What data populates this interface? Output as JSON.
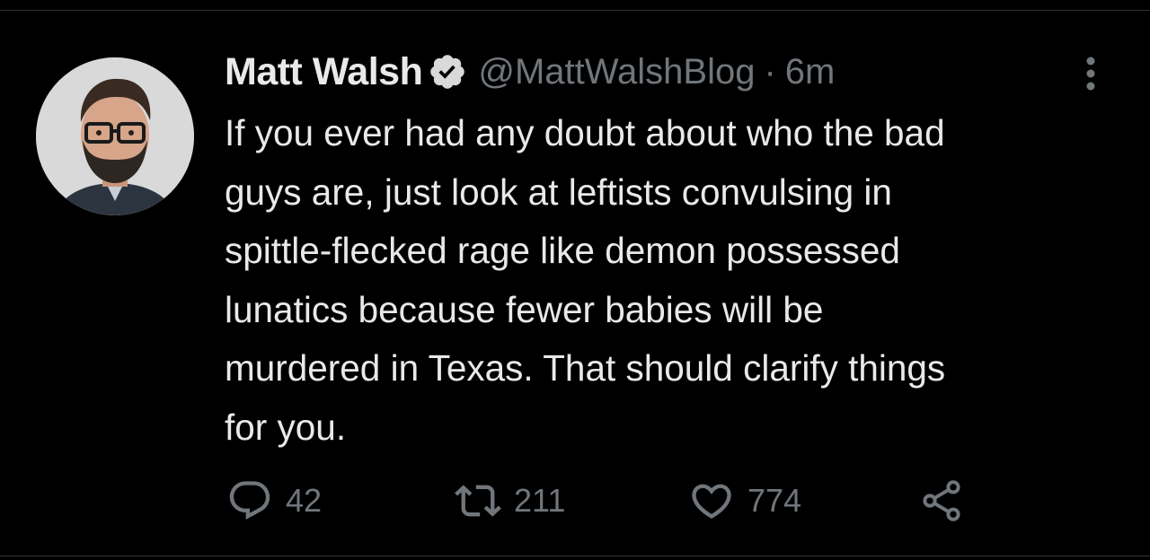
{
  "tweet": {
    "author": {
      "name": "Matt Walsh",
      "handle": "@MattWalshBlog",
      "verified": true,
      "avatar_icon": "profile-photo"
    },
    "separator": "·",
    "time": "6m",
    "text": "If you ever had any doubt about who the bad\nguys are, just look at leftists convulsing in\nspittle-flecked rage like demon possessed\nlunatics because fewer babies will be\nmurdered in Texas. That should clarify things\nfor you.",
    "metrics": {
      "replies": "42",
      "retweets": "211",
      "likes": "774"
    },
    "icons": {
      "more": "more-vertical-icon",
      "reply": "reply-icon",
      "retweet": "retweet-icon",
      "like": "heart-icon",
      "share": "share-icon",
      "verified": "verified-badge-icon"
    }
  },
  "colors": {
    "background": "#000000",
    "primary_text": "#e7e9ea",
    "secondary_text": "#71767b"
  }
}
